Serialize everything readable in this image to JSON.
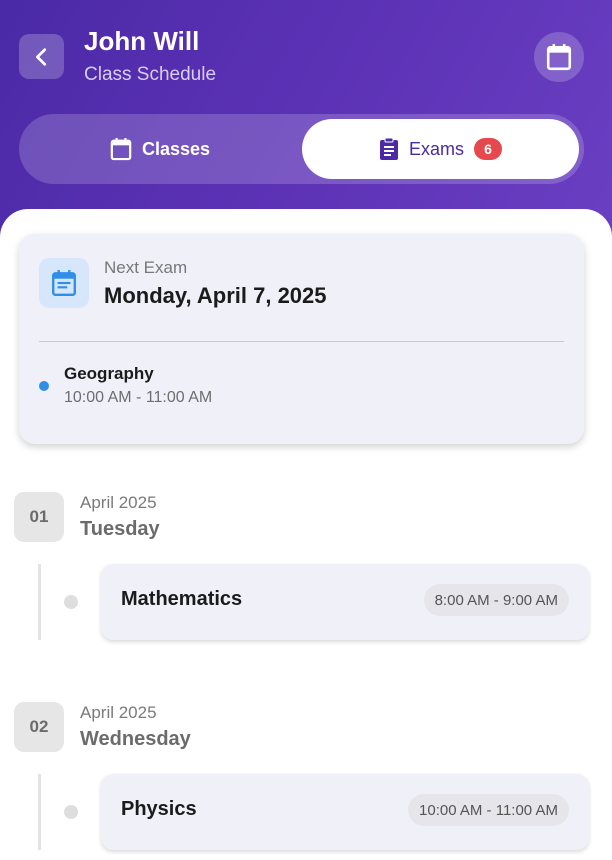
{
  "header": {
    "title": "John Will",
    "subtitle": "Class Schedule",
    "back_icon": "chevron-left-icon",
    "calendar_icon": "calendar-icon"
  },
  "tabs": {
    "classes_label": "Classes",
    "exams_label": "Exams",
    "exams_count": "6",
    "active": "Exams"
  },
  "next_exam": {
    "label": "Next Exam",
    "date": "Monday, April 7, 2025",
    "subject": "Geography",
    "time": "10:00 AM - 11:00 AM"
  },
  "days": [
    {
      "day_number": "01",
      "month": "April 2025",
      "weekday": "Tuesday",
      "subject": "Mathematics",
      "time": "8:00 AM - 9:00 AM"
    },
    {
      "day_number": "02",
      "month": "April 2025",
      "weekday": "Wednesday",
      "subject": "Physics",
      "time": "10:00 AM - 11:00 AM"
    }
  ],
  "colors": {
    "header_start": "#4a2aa6",
    "header_end": "#6a3fc2",
    "badge": "#e5484d",
    "accent_blue": "#2f8fe8"
  }
}
